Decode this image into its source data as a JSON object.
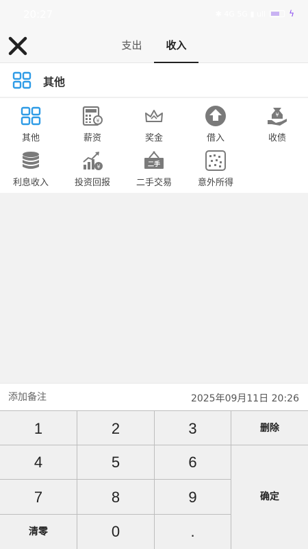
{
  "status_bar": {
    "time": "20:27",
    "indicators": "✱ 4G 5G ▮ ull"
  },
  "header": {
    "close_icon": "close-icon",
    "tabs": [
      {
        "label": "支出",
        "active": false
      },
      {
        "label": "收入",
        "active": true
      }
    ]
  },
  "selected_category": {
    "icon": "grid-icon",
    "label": "其他"
  },
  "categories": [
    {
      "label": "其他",
      "icon": "grid-icon"
    },
    {
      "label": "薪资",
      "icon": "calculator-icon"
    },
    {
      "label": "奖金",
      "icon": "crown-icon"
    },
    {
      "label": "借入",
      "icon": "up-arrow-circle-icon"
    },
    {
      "label": "收债",
      "icon": "money-hand-icon"
    },
    {
      "label": "利息收入",
      "icon": "coin-stack-icon"
    },
    {
      "label": "投资回报",
      "icon": "growth-chart-icon"
    },
    {
      "label": "二手交易",
      "icon": "hanging-sign-icon"
    },
    {
      "label": "意外所得",
      "icon": "surprise-box-icon"
    }
  ],
  "note": {
    "placeholder": "添加备注",
    "datetime": "2025年09月11日 20:26"
  },
  "keypad": {
    "k1": "1",
    "k2": "2",
    "k3": "3",
    "delete": "删除",
    "k4": "4",
    "k5": "5",
    "k6": "6",
    "k7": "7",
    "k8": "8",
    "k9": "9",
    "confirm": "确定",
    "clear": "清零",
    "k0": "0",
    "dot": "."
  },
  "colors": {
    "accent_blue": "#2e9be6",
    "icon_gray": "#7a7a7a",
    "background": "#f2f2f2"
  }
}
